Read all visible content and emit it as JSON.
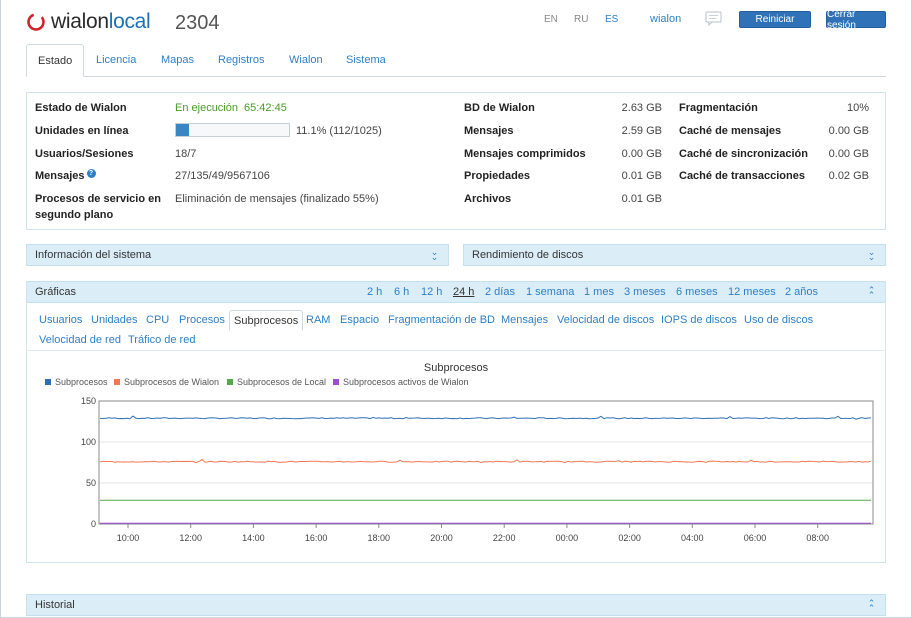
{
  "header": {
    "brand_prefix": "wialon",
    "brand_suffix": "local",
    "version": "2304",
    "languages": [
      {
        "code": "EN",
        "active": false
      },
      {
        "code": "RU",
        "active": false
      },
      {
        "code": "ES",
        "active": true
      }
    ],
    "user": "wialon",
    "restart_label": "Reiniciar",
    "logout_label": "Cerrar sesión"
  },
  "tabs": [
    "Estado",
    "Licencia",
    "Mapas",
    "Registros",
    "Wialon",
    "Sistema"
  ],
  "status": {
    "left": [
      {
        "label": "Estado de Wialon",
        "value": "En ejecución",
        "value2": "65:42:45"
      },
      {
        "label": "Unidades en línea",
        "value": "11.1% (112/1025)",
        "progress": 0.111
      },
      {
        "label": "Usuarios/Sesiones",
        "value": "18/7"
      },
      {
        "label": "Mensajes",
        "value": "27/135/49/9567106"
      },
      {
        "label_line1": "Procesos de servicio en",
        "label_line2": "segundo plano",
        "value": "Eliminación de mensajes (finalizado 55%)"
      }
    ],
    "middle": [
      {
        "label": "BD de Wialon",
        "value": "2.63 GB"
      },
      {
        "label": "Mensajes",
        "value": "2.59 GB"
      },
      {
        "label": "Mensajes comprimidos",
        "value": "0.00 GB"
      },
      {
        "label": "Propiedades",
        "value": "0.01 GB"
      },
      {
        "label": "Archivos",
        "value": "0.01 GB"
      }
    ],
    "right": [
      {
        "label": "Fragmentación",
        "value": "10%"
      },
      {
        "label": "Caché de mensajes",
        "value": "0.00 GB"
      },
      {
        "label": "Caché de sincronización",
        "value": "0.00 GB"
      },
      {
        "label": "Caché de transacciones",
        "value": "0.02 GB"
      }
    ]
  },
  "panels": {
    "system_info": "Información del sistema",
    "disk_performance": "Rendimiento de discos",
    "graphs": "Gráficas",
    "history": "Historial"
  },
  "time_ranges": [
    "2 h",
    "6 h",
    "12 h",
    "24 h",
    "2 días",
    "1 semana",
    "1 mes",
    "3 meses",
    "6 meses",
    "12 meses",
    "2 años"
  ],
  "time_range_active": "24 h",
  "graph_tabs_row1": [
    "Usuarios",
    "Unidades",
    "CPU",
    "Procesos",
    "Subprocesos",
    "RAM",
    "Espacio",
    "Fragmentación de BD",
    "Mensajes",
    "Velocidad de discos",
    "IOPS de discos",
    "Uso de discos"
  ],
  "graph_tabs_row2": [
    "Velocidad de red",
    "Tráfico de red"
  ],
  "graph_tab_active": "Subprocesos",
  "colors": {
    "accent": "#2d7fc6",
    "button": "#2f72b8",
    "panel_bar": "#dbeef8",
    "running": "#4a9a2a"
  },
  "chart_data": {
    "type": "line",
    "title": "Subprocesos",
    "x_ticks": [
      "10:00",
      "12:00",
      "14:00",
      "16:00",
      "18:00",
      "20:00",
      "22:00",
      "00:00",
      "02:00",
      "04:00",
      "06:00",
      "08:00"
    ],
    "ylim": [
      0,
      150
    ],
    "y_ticks": [
      0,
      50,
      100,
      150
    ],
    "series": [
      {
        "name": "Subprocesos",
        "color": "#2f6fb5",
        "approx_value": 129
      },
      {
        "name": "Subprocesos de Wialon",
        "color": "#f07a50",
        "approx_value": 76
      },
      {
        "name": "Subprocesos de Local",
        "color": "#55a84a",
        "approx_value": 29
      },
      {
        "name": "Subprocesos activos de Wialon",
        "color": "#9b4fd0",
        "approx_value": 1
      }
    ]
  }
}
